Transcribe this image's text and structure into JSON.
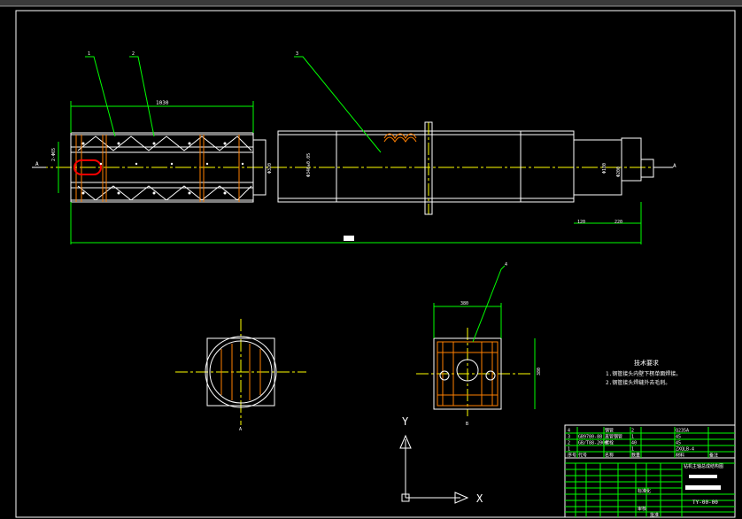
{
  "colors": {
    "background": "#000000",
    "frame": "#ffffff",
    "outline": "#ffffff",
    "leader": "#00ff00",
    "dimension": "#00ff00",
    "centerline": "#ffff00",
    "hatch": "#ff7f00",
    "pipe": "#ff0000",
    "text": "#ffffff"
  },
  "balloons": {
    "b1": "1",
    "b2": "2",
    "b3": "3",
    "b4": "4"
  },
  "dimensions": {
    "overall_top": "1030",
    "left_v": "2-Φ65",
    "d_main": "Φ320",
    "d_body": "Φ340±0.05",
    "d_right1": "Φ180",
    "d_right2": "Φ200",
    "right_a": "120",
    "right_b": "220",
    "section_w": "380",
    "section_h": "380"
  },
  "views": {
    "section_a": "A",
    "section_b": "B",
    "arrow_left": "A",
    "arrow_right": "A"
  },
  "axes": {
    "y": "Y",
    "x": "X"
  },
  "tech_notes": {
    "title": "技术要求",
    "note1": "1.钢管接头内壁下楞单面焊接。",
    "note2": "2.钢管接头焊缝外去毛刺。"
  },
  "bom": {
    "rows": [
      {
        "no": "4",
        "code": "",
        "name": "钢管",
        "qty": "2",
        "material": "Q235A",
        "remark": ""
      },
      {
        "no": "3",
        "code": "GB9780-88",
        "name": "直管钢管",
        "qty": "1",
        "material": "45",
        "remark": ""
      },
      {
        "no": "2",
        "code": "GB/T88-2000",
        "name": "螺栓",
        "qty": "40",
        "material": "45",
        "remark": ""
      },
      {
        "no": "1",
        "code": "",
        "name": "",
        "qty": "1",
        "material": "ZXQLB-4",
        "remark": ""
      }
    ],
    "header": {
      "no": "序号",
      "code": "代号",
      "name": "名称",
      "qty": "数量",
      "material": "材料",
      "remark": "备注"
    }
  },
  "title_block": {
    "drawing_title": "钻机主轴总成结构图",
    "drawing_no": "TY-00-00",
    "label_design": "标准化",
    "label_check": "审核",
    "label_approve": "批准"
  }
}
